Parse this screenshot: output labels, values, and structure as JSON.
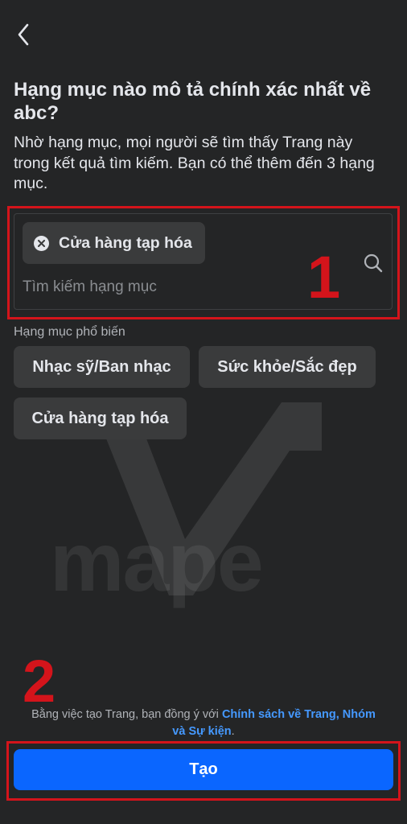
{
  "header": {
    "back_icon": "chevron-left-icon"
  },
  "title": "Hạng mục nào mô tả chính xác nhất về abc?",
  "description": "Nhờ hạng mục, mọi người sẽ tìm thấy Trang này trong kết quả tìm kiếm. Bạn có thể thêm đến 3 hạng mục.",
  "search": {
    "selected_chip": "Cửa hàng tạp hóa",
    "chip_remove_icon": "close-circle-icon",
    "placeholder": "Tìm kiếm hạng mục",
    "value": "",
    "search_icon": "search-icon"
  },
  "annotations": {
    "first": "1",
    "second": "2",
    "color": "#d4141b"
  },
  "popular": {
    "label": "Hạng mục phổ biến",
    "items": [
      "Nhạc sỹ/Ban nhạc",
      "Sức khỏe/Sắc đẹp",
      "Cửa hàng tạp hóa"
    ]
  },
  "watermark": {
    "text": "mape"
  },
  "terms": {
    "prefix": "Bằng việc tạo Trang, bạn đồng ý với ",
    "link": "Chính sách về Trang, Nhóm và Sự kiện",
    "suffix": "."
  },
  "footer": {
    "create_label": "Tạo"
  },
  "colors": {
    "background": "#242526",
    "accent": "#0a66ff",
    "link": "#4599ff",
    "chip": "#3a3b3c",
    "annotation": "#d4141b"
  }
}
